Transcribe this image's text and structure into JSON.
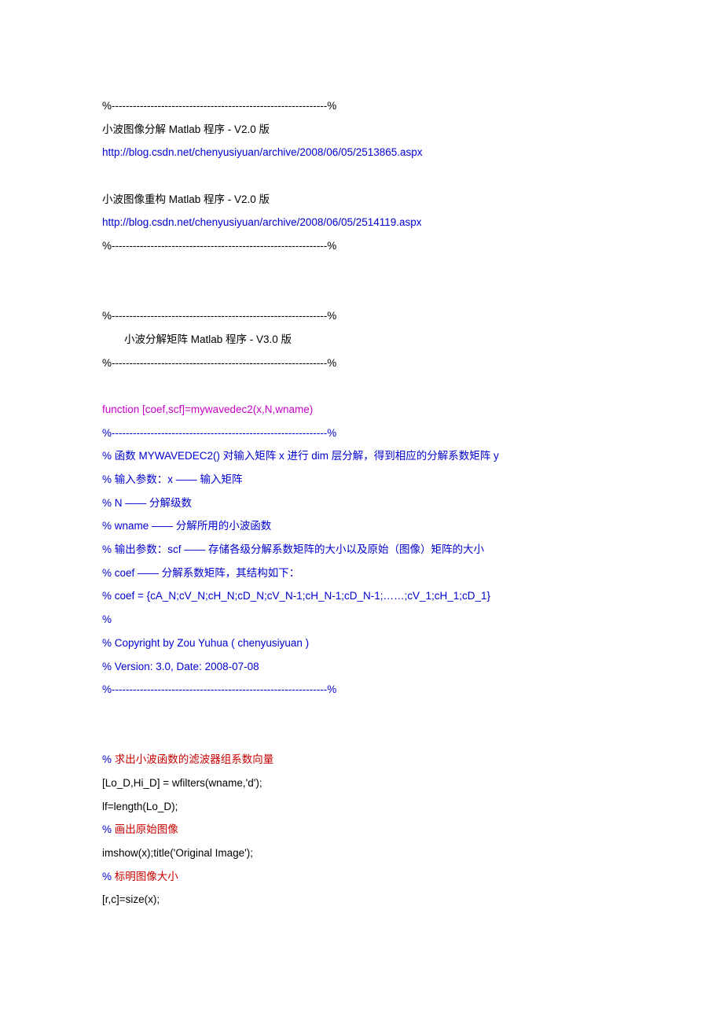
{
  "lines": {
    "sep1": "%-------------------------------------------------------------%",
    "title1": "小波图像分解 Matlab 程序 - V2.0 版",
    "url1": "http://blog.csdn.net/chenyusiyuan/archive/2008/06/05/2513865.aspx",
    "title2": "小波图像重构 Matlab 程序 - V2.0 版",
    "url2": "http://blog.csdn.net/chenyusiyuan/archive/2008/06/05/2514119.aspx",
    "sep2": "%-------------------------------------------------------------%",
    "sep3": "%-------------------------------------------------------------%",
    "title3": "小波分解矩阵 Matlab 程序 - V3.0 版",
    "sep4": "%-------------------------------------------------------------%",
    "funcdecl": "function [coef,scf]=mywavedec2(x,N,wname)",
    "sep5": "%-------------------------------------------------------------%",
    "c1": "% 函数 MYWAVEDEC2() 对输入矩阵 x 进行 dim 层分解，得到相应的分解系数矩阵 y",
    "c2": "% 输入参数：x —— 输入矩阵",
    "c3": "%         N —— 分解级数",
    "c4": "%         wname —— 分解所用的小波函数",
    "c5": "% 输出参数：scf —— 存储各级分解系数矩阵的大小以及原始（图像）矩阵的大小",
    "c6": "%           coef —— 分解系数矩阵，其结构如下：",
    "c7": "% coef = {cA_N;cV_N;cH_N;cD_N;cV_N-1;cH_N-1;cD_N-1;……;cV_1;cH_1;cD_1}",
    "c8": "%",
    "c9": "% Copyright by Zou Yuhua ( chenyusiyuan )",
    "c10": "% Version: 3.0, Date: 2008-07-08",
    "sep6": "%-------------------------------------------------------------%",
    "r1_pct": "%  ",
    "r1_txt": "求出小波函数的滤波器组系数向量",
    "b1": "[Lo_D,Hi_D] = wfilters(wname,'d');",
    "b2": "lf=length(Lo_D);",
    "r2_pct": "%  ",
    "r2_txt": "画出原始图像",
    "b3": "imshow(x);title('Original Image');",
    "r3_pct": "%  ",
    "r3_txt": "标明图像大小",
    "b4": "[r,c]=size(x);"
  }
}
